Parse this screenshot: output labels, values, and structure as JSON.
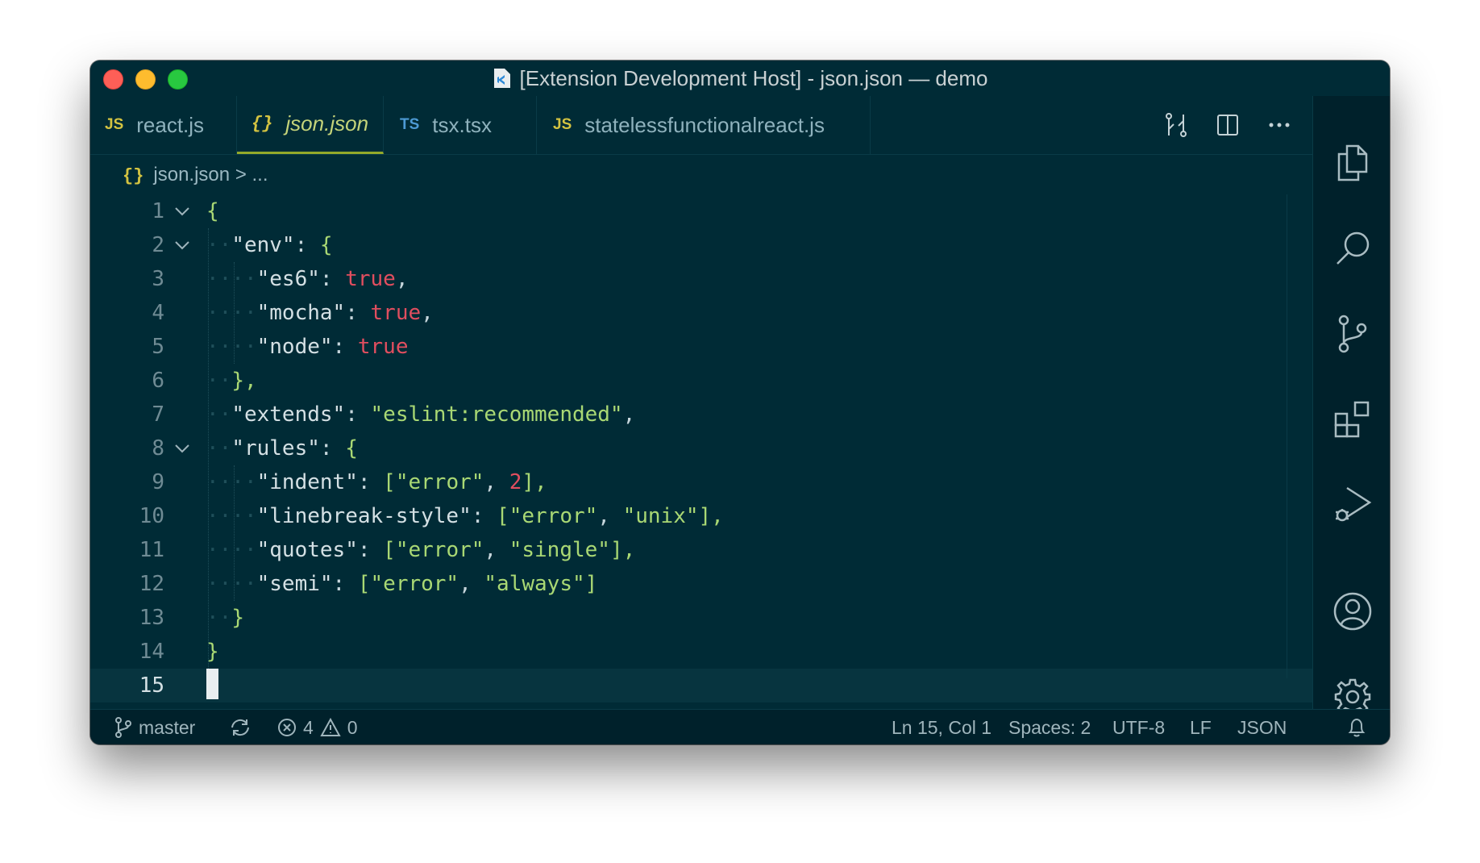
{
  "window": {
    "title": "[Extension Development Host] - json.json — demo"
  },
  "tabs": [
    {
      "icon_text": "JS",
      "label": "react.js",
      "active": false,
      "icon_color": "#d3c341"
    },
    {
      "icon_text": "{}",
      "label": "json.json",
      "active": true,
      "icon_color": "#d3c341"
    },
    {
      "icon_text": "TS",
      "label": "tsx.tsx",
      "active": false,
      "icon_color": "#4d9ad4"
    },
    {
      "icon_text": "JS",
      "label": "statelessfunctionalreact.js",
      "active": false,
      "icon_color": "#d3c341"
    }
  ],
  "tab_actions": [
    "open-changes-icon",
    "split-editor-icon",
    "more-actions-icon"
  ],
  "breadcrumb": {
    "icon_text": "{}",
    "file": "json.json",
    "separator": ">",
    "rest": "..."
  },
  "editor": {
    "lines": [
      {
        "n": "1"
      },
      {
        "n": "2"
      },
      {
        "n": "3"
      },
      {
        "n": "4"
      },
      {
        "n": "5"
      },
      {
        "n": "6"
      },
      {
        "n": "7"
      },
      {
        "n": "8"
      },
      {
        "n": "9"
      },
      {
        "n": "10"
      },
      {
        "n": "11"
      },
      {
        "n": "12"
      },
      {
        "n": "13"
      },
      {
        "n": "14"
      },
      {
        "n": "15"
      }
    ],
    "tokens": {
      "l1": "{",
      "l2_key": "\"env\"",
      "l2_rest": ": ",
      "l2_brace": "{",
      "l3_key": "\"es6\"",
      "l3_colon": ": ",
      "l3_val": "true",
      "l3_end": ",",
      "l4_key": "\"mocha\"",
      "l4_colon": ": ",
      "l4_val": "true",
      "l4_end": ",",
      "l5_key": "\"node\"",
      "l5_colon": ": ",
      "l5_val": "true",
      "l6": "},",
      "l7_key": "\"extends\"",
      "l7_colon": ": ",
      "l7_val": "\"eslint:recommended\"",
      "l7_end": ",",
      "l8_key": "\"rules\"",
      "l8_colon": ": ",
      "l8_brace": "{",
      "l9_key": "\"indent\"",
      "l9_colon": ": ",
      "l9_open": "[",
      "l9_s1": "\"error\"",
      "l9_comma": ", ",
      "l9_num": "2",
      "l9_close": "],",
      "l10_key": "\"linebreak-style\"",
      "l10_colon": ": ",
      "l10_open": "[",
      "l10_s1": "\"error\"",
      "l10_comma": ", ",
      "l10_s2": "\"unix\"",
      "l10_close": "],",
      "l11_key": "\"quotes\"",
      "l11_colon": ": ",
      "l11_open": "[",
      "l11_s1": "\"error\"",
      "l11_comma": ", ",
      "l11_s2": "\"single\"",
      "l11_close": "],",
      "l12_key": "\"semi\"",
      "l12_colon": ": ",
      "l12_open": "[",
      "l12_s1": "\"error\"",
      "l12_comma": ", ",
      "l12_s2": "\"always\"",
      "l12_close": "]",
      "l13": "}",
      "l14": "}"
    }
  },
  "activity_bar": [
    "explorer-icon",
    "search-icon",
    "source-control-icon",
    "extensions-icon",
    "run-debug-icon",
    "accounts-icon",
    "settings-gear-icon"
  ],
  "statusbar": {
    "branch": "master",
    "errors": "4",
    "warnings": "0",
    "position": "Ln 15, Col 1",
    "spaces": "Spaces: 2",
    "encoding": "UTF-8",
    "eol": "LF",
    "language": "JSON"
  },
  "colors": {
    "background": "#002b36",
    "accent": "#93a92a",
    "boolean": "#e14e5f",
    "string": "#a9d874"
  }
}
